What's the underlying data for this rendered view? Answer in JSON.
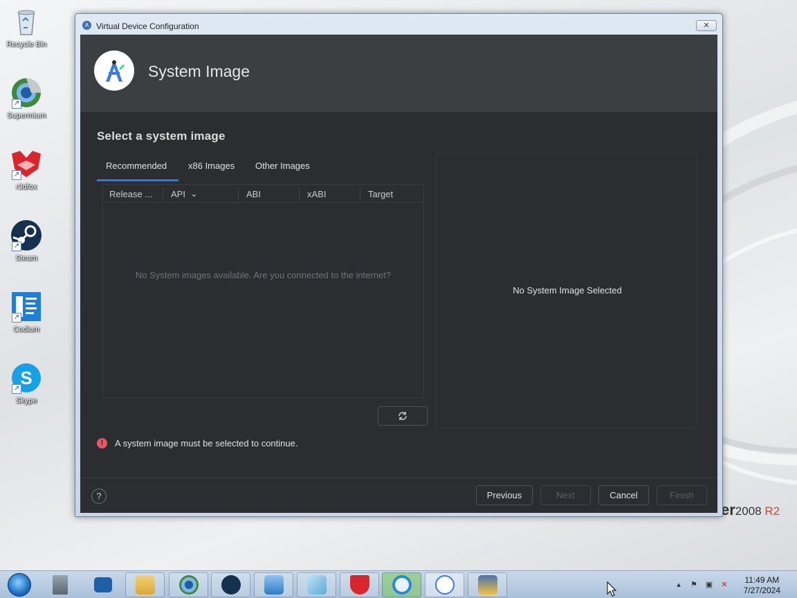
{
  "desktop": {
    "icons": [
      {
        "label": "Recycle Bin",
        "icon": "recycle-bin-icon"
      },
      {
        "label": "Supermium",
        "icon": "supermium-icon"
      },
      {
        "label": "r3dfox",
        "icon": "r3dfox-icon"
      },
      {
        "label": "Steam",
        "icon": "steam-icon"
      },
      {
        "label": "Codium",
        "icon": "codium-icon"
      },
      {
        "label": "Skype",
        "icon": "skype-icon"
      }
    ],
    "watermark_main": "er",
    "watermark_year": "2008",
    "watermark_r2": "R2"
  },
  "window": {
    "title": "Virtual Device Configuration",
    "close_glyph": "✕"
  },
  "header": {
    "title": "System Image"
  },
  "content": {
    "subtitle": "Select a system image",
    "tabs": [
      "Recommended",
      "x86 Images",
      "Other Images"
    ],
    "table": {
      "columns": [
        "Release ...",
        "API",
        "ABI",
        "xABI",
        "Target"
      ],
      "empty_message": "No System images available. Are you connected to the internet?"
    },
    "details_message": "No System Image Selected",
    "error_message": "A system image must be selected to continue."
  },
  "footer": {
    "help_glyph": "?",
    "previous_label": "Previous",
    "next_label": "Next",
    "cancel_label": "Cancel",
    "finish_label": "Finish"
  },
  "taskbar": {
    "time": "11:49 AM",
    "date": "7/27/2024"
  },
  "colors": {
    "accent": "#3574f0",
    "error": "#e55765",
    "dialog_bg": "#2b2d30",
    "header_bg": "#3c3f41"
  }
}
